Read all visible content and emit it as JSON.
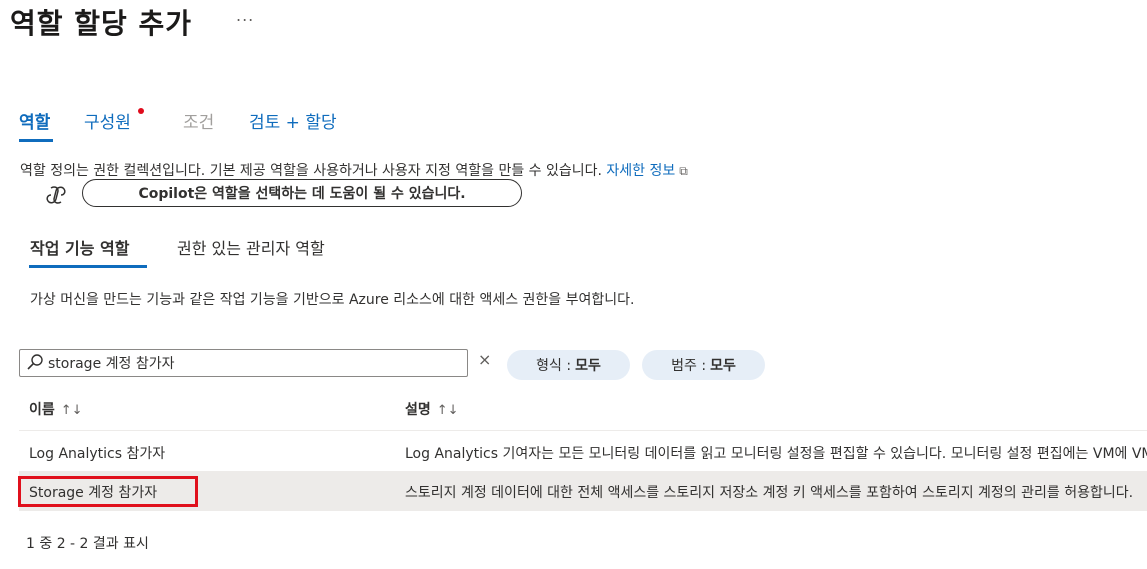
{
  "page": {
    "title": "역할 할당 추가",
    "more_label": "..."
  },
  "tabs": [
    {
      "label": "역할",
      "state": "active"
    },
    {
      "label": "구성원",
      "state": "normal",
      "badge": "red-dot"
    },
    {
      "label": "조건",
      "state": "disabled"
    },
    {
      "label": "검토 + 할당",
      "state": "normal"
    }
  ],
  "role_description": {
    "text": "역할 정의는 권한 컬렉션입니다. 기본 제공 역할을 사용하거나 사용자 지정 역할을 만들 수 있습니다.",
    "link": "자세한 정보",
    "link_icon": "external-link-icon"
  },
  "copilot": {
    "icon": "copilot-icon",
    "prompt": "Copilot은 역할을 선택하는 데 도움이 될 수 있습니다."
  },
  "subtabs": [
    {
      "label": "작업 기능 역할",
      "state": "active"
    },
    {
      "label": "권한 있는 관리자 역할",
      "state": "normal"
    }
  ],
  "subtab_description": "가상 머신을 만드는 기능과 같은 작업 기능을 기반으로 Azure 리소스에 대한 액세스 권한을 부여합니다.",
  "search": {
    "value": "storage 계정 참가자",
    "icon": "search-icon",
    "clear_label": "×"
  },
  "filters": [
    {
      "label": "형식 :",
      "value": "모두"
    },
    {
      "label": "범주 :",
      "value": "모두"
    }
  ],
  "table": {
    "columns": [
      {
        "label": "이름",
        "sort": "↑↓"
      },
      {
        "label": "설명",
        "sort": "↑↓"
      }
    ],
    "rows": [
      {
        "name": "Log Analytics 참가자",
        "description": "Log Analytics 기여자는 모든 모니터링 데이터를 읽고 모니터링 설정을 편집할 수 있습니다. 모니터링 설정 편집에는 VM에 VM 확장 추가"
      },
      {
        "name": "Storage 계정 참가자",
        "description": "스토리지 계정 데이터에 대한 전체 액세스를 스토리지 저장소 계정 키 액세스를 포함하여 스토리지 계정의 관리를 허용합니다.",
        "selected": true
      }
    ]
  },
  "pagination": "1 중 2 - 2 결과 표시",
  "colors": {
    "accent": "#0f6cbd",
    "highlight": "#e0101c",
    "selected_row": "#edebe9",
    "pill_bg": "#e6eef7"
  }
}
